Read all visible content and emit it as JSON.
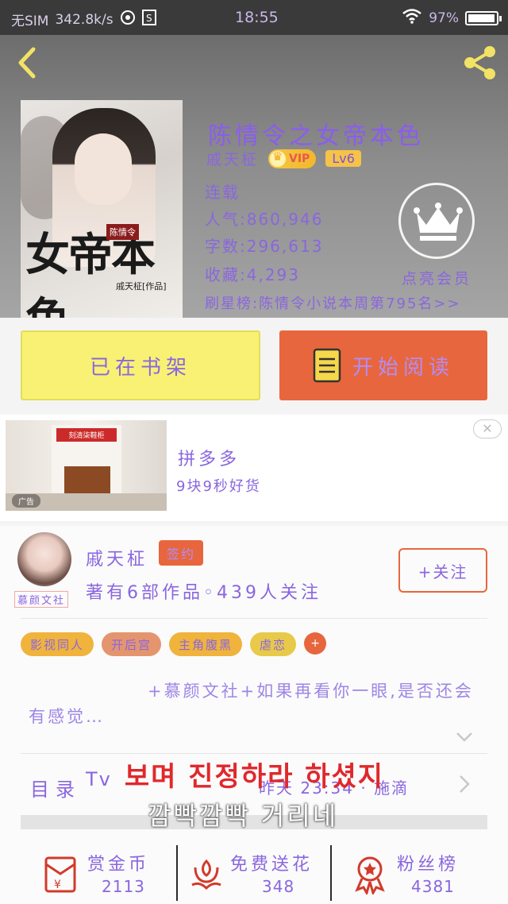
{
  "status_bar": {
    "carrier": "无SIM",
    "speed": "342.8k/s",
    "time": "18:55",
    "battery": "97%",
    "battery_level": 0.97
  },
  "book": {
    "title": "陈情令之女帝本色",
    "author": "戚天柾",
    "vip_label": "VIP",
    "level": "Lv6",
    "status": "连载",
    "popularity": "人气:860,946",
    "word_count": "字数:296,613",
    "favorites": "收藏:4,293",
    "member_link": "点亮会员",
    "rank": "刷星榜:陈情令小说本周第795名>>",
    "cover_title": "女帝本色",
    "cover_series": "陈情令",
    "cover_author": "戚天柾[作品]"
  },
  "actions": {
    "shelf_label": "已在书架",
    "read_label": "开始阅读"
  },
  "ad": {
    "name": "拼多多",
    "slogan": "9块9秒好货",
    "image_title": "刻清柒鞋柜",
    "image_tag": "广告",
    "close": "✕"
  },
  "author_card": {
    "name": "戚天柾",
    "signed": "签约",
    "avatar_tag": "慕颜文社",
    "stats": "著有6部作品◦439人关注",
    "follow_label": "+关注",
    "tags": [
      {
        "label": "影视同人",
        "color": "#f0b33c"
      },
      {
        "label": "开后宫",
        "color": "#e4956e"
      },
      {
        "label": "主角腹黑",
        "color": "#f0b33c"
      },
      {
        "label": "虐恋",
        "color": "#e8c94a"
      }
    ],
    "tag_more": "+",
    "intro": "+慕颜文社+如果再看你一眼,是否还会有感觉…"
  },
  "toc": {
    "label": "目录",
    "update": "昨天 23:34 · 施滴"
  },
  "subtitle": {
    "tv": "Tv",
    "line1": "보며 진정하라 하셨지",
    "line2": "깜빡깜빡 거리네"
  },
  "bottom_stats": [
    {
      "label": "赏金币",
      "value": "2113",
      "icon": "red-envelope-icon"
    },
    {
      "label": "免费送花",
      "value": "348",
      "icon": "flower-icon"
    },
    {
      "label": "粉丝榜",
      "value": "4381",
      "icon": "medal-icon"
    }
  ],
  "colors": {
    "accent": "#e8663d",
    "text_purple": "#8a66df",
    "shelf_yellow": "#f8f173"
  }
}
